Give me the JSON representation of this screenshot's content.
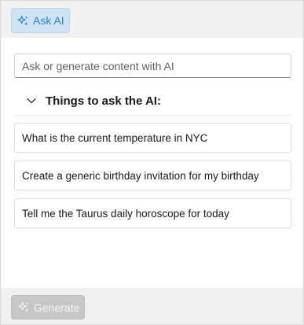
{
  "header": {
    "ask_ai_label": "Ask AI",
    "ask_ai_icon": "sparkle-icon",
    "accent_color": "#2f7fc4"
  },
  "search": {
    "placeholder": "Ask or generate content with AI",
    "value": ""
  },
  "suggestions": {
    "title": "Things to ask the AI:",
    "expanded": true,
    "items": [
      {
        "label": "What is the current temperature in NYC"
      },
      {
        "label": "Create a generic birthday invitation for my birthday"
      },
      {
        "label": "Tell me the Taurus daily horoscope for today"
      }
    ]
  },
  "footer": {
    "generate_label": "Generate",
    "generate_icon": "sparkle-icon",
    "generate_enabled": false
  }
}
